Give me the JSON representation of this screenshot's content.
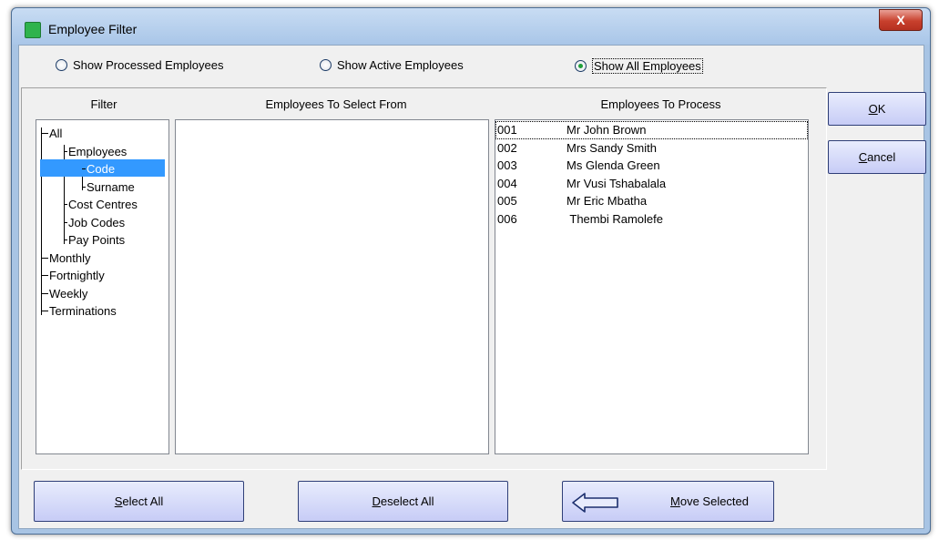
{
  "window": {
    "title": "Employee Filter",
    "close_glyph": "X"
  },
  "filter_mode": {
    "options": [
      {
        "label": "Show Processed Employees",
        "checked": false
      },
      {
        "label": "Show Active Employees",
        "checked": false
      },
      {
        "label": "Show All Employees",
        "checked": true
      }
    ]
  },
  "columns": {
    "filter": "Filter",
    "select_from": "Employees To Select From",
    "to_process": "Employees To Process"
  },
  "tree": {
    "items": [
      {
        "label": "All",
        "level": 0,
        "selected": false
      },
      {
        "label": "Employees",
        "level": 1,
        "selected": false
      },
      {
        "label": "Code",
        "level": 2,
        "selected": true
      },
      {
        "label": "Surname",
        "level": 2,
        "selected": false
      },
      {
        "label": "Cost Centres",
        "level": 1,
        "selected": false
      },
      {
        "label": "Job Codes",
        "level": 1,
        "selected": false
      },
      {
        "label": "Pay Points",
        "level": 1,
        "selected": false
      },
      {
        "label": "Monthly",
        "level": 0,
        "selected": false
      },
      {
        "label": "Fortnightly",
        "level": 0,
        "selected": false
      },
      {
        "label": "Weekly",
        "level": 0,
        "selected": false
      },
      {
        "label": "Terminations",
        "level": 0,
        "selected": false
      }
    ]
  },
  "select_from": [],
  "to_process": [
    {
      "code": "001",
      "name": "Mr John Brown"
    },
    {
      "code": "002",
      "name": "Mrs Sandy Smith"
    },
    {
      "code": "003",
      "name": "Ms Glenda Green"
    },
    {
      "code": "004",
      "name": "Mr Vusi Tshabalala"
    },
    {
      "code": "005",
      "name": "Mr Eric Mbatha"
    },
    {
      "code": "006",
      "name": " Thembi Ramolefe"
    }
  ],
  "buttons": {
    "ok": {
      "mnemonic": "O",
      "rest": "K"
    },
    "cancel": {
      "mnemonic": "C",
      "rest": "ancel"
    },
    "select_all": {
      "mnemonic": "S",
      "rest": "elect All"
    },
    "deselect_all": {
      "mnemonic": "D",
      "rest": "eselect All"
    },
    "move_selected": {
      "mnemonic": "M",
      "rest": "ove Selected",
      "icon": "left-arrow-icon"
    }
  },
  "colors": {
    "selection": "#3399ff",
    "button_border": "#2f3f78",
    "app_icon": "#2fb34d"
  }
}
